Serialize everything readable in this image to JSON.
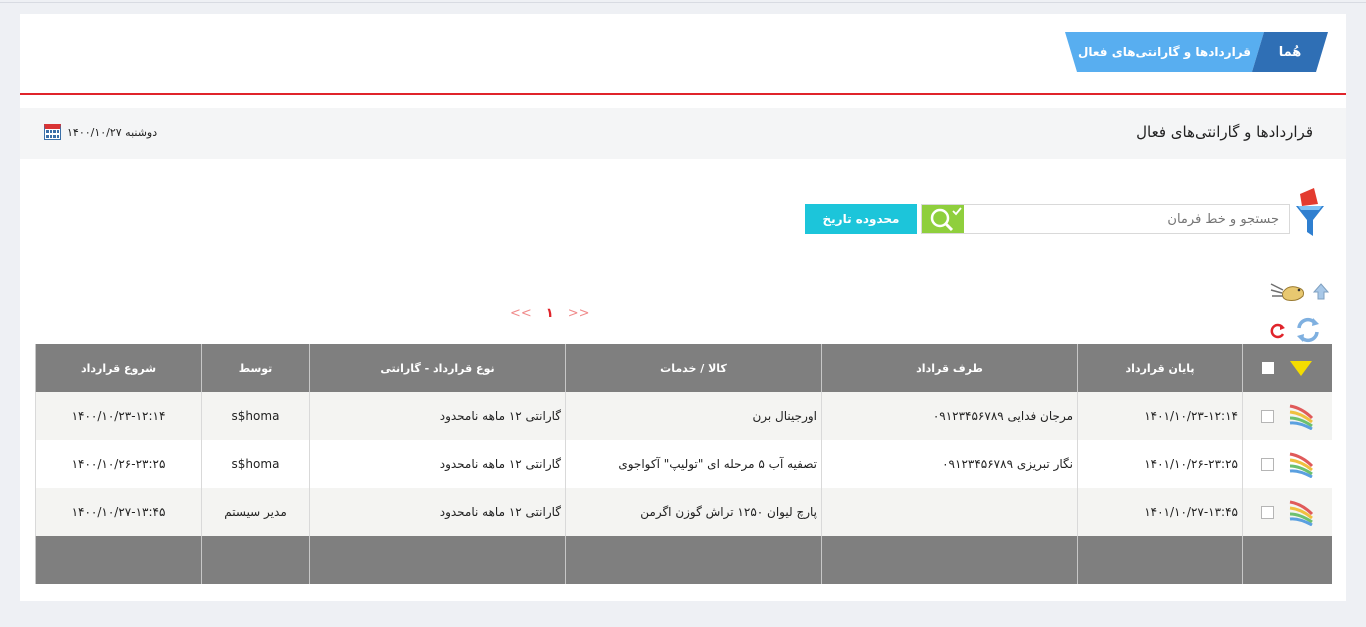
{
  "breadcrumb": {
    "home": "هُما",
    "current": "قراردادها و گارانتی‌های فعال"
  },
  "page": {
    "title": "قراردادها و گارانتی‌های فعال",
    "date": "دوشنبه ۱۴۰۰/۱۰/۲۷"
  },
  "search": {
    "placeholder": "جستجو و خط فرمان",
    "value": "",
    "date_range_label": "محدوده تاریخ"
  },
  "pager": {
    "prev": "<<",
    "current": "۱",
    "next": ">>"
  },
  "table": {
    "columns": [
      "پایان قرارداد",
      "طرف قراداد",
      "کالا / خدمات",
      "نوع قرارداد - گارانتی",
      "توسط",
      "شروع قرارداد"
    ],
    "rows": [
      {
        "end": "۱۴۰۱/۱۰/۲۳-۱۲:۱۴",
        "party": "مرجان فدایی ۰۹۱۲۳۴۵۶۷۸۹",
        "goods": "اورجینال برن",
        "type": "گارانتی ۱۲ ماهه نامحدود",
        "by": "s$homa",
        "start": "۱۴۰۰/۱۰/۲۳-۱۲:۱۴"
      },
      {
        "end": "۱۴۰۱/۱۰/۲۶-۲۳:۲۵",
        "party": "نگار تبریزی ۰۹۱۲۳۴۵۶۷۸۹",
        "goods": "تصفیه آب ۵ مرحله ای \"تولیپ\" آکواجوی",
        "type": "گارانتی ۱۲ ماهه نامحدود",
        "by": "s$homa",
        "start": "۱۴۰۰/۱۰/۲۶-۲۳:۲۵"
      },
      {
        "end": "۱۴۰۱/۱۰/۲۷-۱۳:۴۵",
        "party": "",
        "goods": "پارچ لیوان ۱۲۵۰ تراش گوزن اگرمن",
        "type": "گارانتی ۱۲ ماهه نامحدود",
        "by": "مدیر سیستم",
        "start": "۱۴۰۰/۱۰/۲۷-۱۳:۴۵"
      }
    ]
  },
  "colors": {
    "accent_red": "#e0242b",
    "breadcrumb_home": "#2f6fb5",
    "breadcrumb_page": "#58aef0",
    "search_button": "#8fcf3d",
    "date_range_button": "#1cc5da",
    "table_header": "#7f7f7f"
  },
  "icons": {
    "calendar": "calendar-icon",
    "funnel": "funnel-filter-icon",
    "search": "magnifier-icon",
    "tools": [
      "bird-icon",
      "upload-icon",
      "refresh-icon",
      "reload-icon"
    ],
    "row": "rainbow-icon",
    "header_menu": "triangle-down-icon"
  }
}
